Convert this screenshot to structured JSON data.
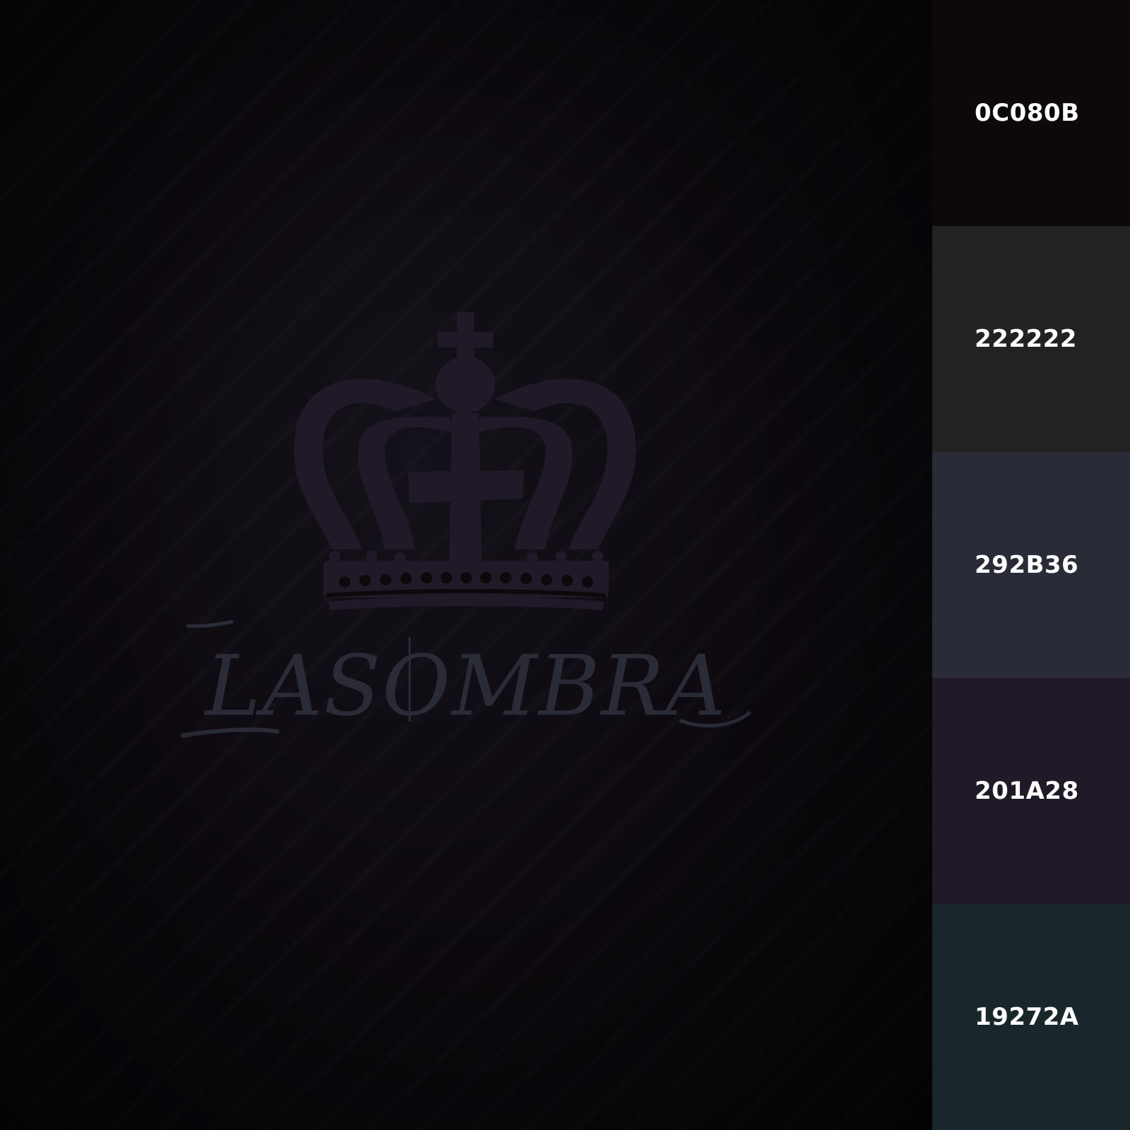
{
  "artwork": {
    "logo_text": "LASOMBRA",
    "crown_color": "#201A28",
    "text_color": "#292B36",
    "background_color": "#0C080B"
  },
  "palette": [
    {
      "hex_label": "0C080B",
      "color": "#0C080B"
    },
    {
      "hex_label": "222222",
      "color": "#222222"
    },
    {
      "hex_label": "292B36",
      "color": "#292B36"
    },
    {
      "hex_label": "201A28",
      "color": "#201A28"
    },
    {
      "hex_label": "19272A",
      "color": "#19272A"
    }
  ]
}
